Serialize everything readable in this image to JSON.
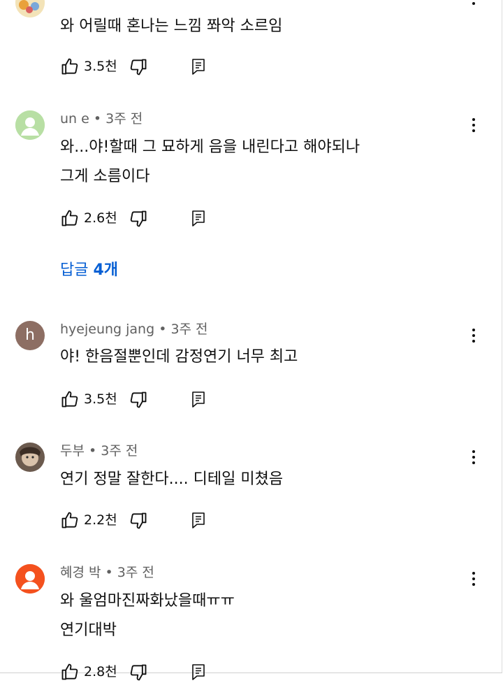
{
  "comments": [
    {
      "author": "",
      "meta": "",
      "lines": [
        "와  어릴때 혼나는 느낌 쫘악 소르임"
      ],
      "likes": "3.5천"
    },
    {
      "author": "un e",
      "meta": "un e • 3주 전",
      "lines": [
        "와...야!할때 그 묘하게 음을 내린다고 해야되나",
        "그게 소름이다"
      ],
      "likes": "2.6천",
      "avatar_color": "#b8dfa4"
    },
    {
      "author": "hyejeung jang",
      "meta": "hyejeung jang • 3주 전",
      "avatar_letter": "h",
      "lines": [
        "야! 한음절뿐인데 감정연기 너무 최고"
      ],
      "likes": "3.5천",
      "avatar_color": "#8d6e63"
    },
    {
      "author": "두부",
      "meta": "두부 • 3주 전",
      "lines": [
        "연기 정말 잘한다.... 디테일 미쳤음"
      ],
      "likes": "2.2천"
    },
    {
      "author": "혜경 박",
      "meta": "혜경 박 • 3주 전",
      "lines": [
        "와 울엄마진짜화났을때ㅠㅠ",
        "연기대박"
      ],
      "likes": "2.8천",
      "avatar_color": "#f4511e"
    }
  ],
  "replies": {
    "label": "답글 ",
    "count": "4개"
  },
  "icons": {
    "like": "thumbs-up-icon",
    "dislike": "thumbs-down-icon",
    "reply": "reply-icon",
    "menu": "more-vert-icon"
  },
  "colors": {
    "link": "#065fd4",
    "meta": "#606060",
    "text": "#0f0f0f"
  }
}
